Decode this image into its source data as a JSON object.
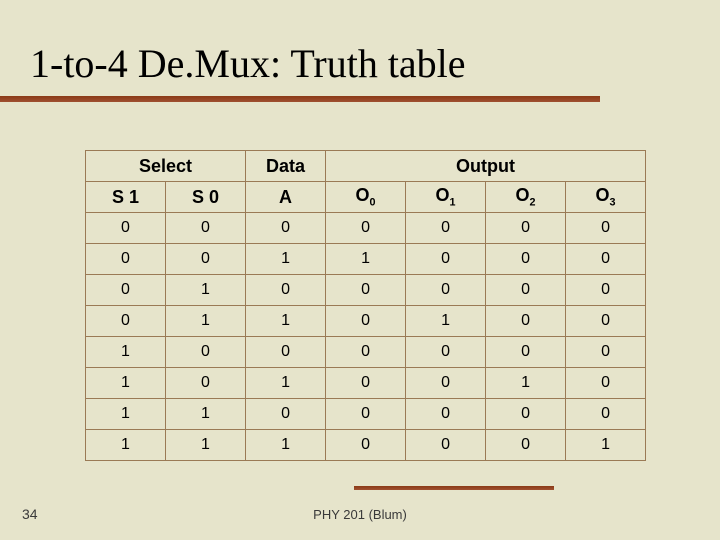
{
  "title": "1-to-4 De.Mux: Truth table",
  "footer": "PHY 201 (Blum)",
  "slide_number": "34",
  "table": {
    "group_headers": {
      "select": "Select",
      "data": "Data",
      "output": "Output"
    },
    "col_headers": {
      "s1": "S 1",
      "s0": "S 0",
      "a": "A",
      "o0_label": "O",
      "o0_sub": "0",
      "o1_label": "O",
      "o1_sub": "1",
      "o2_label": "O",
      "o2_sub": "2",
      "o3_label": "O",
      "o3_sub": "3"
    },
    "rows": [
      {
        "s1": "0",
        "s0": "0",
        "a": "0",
        "o0": "0",
        "o1": "0",
        "o2": "0",
        "o3": "0"
      },
      {
        "s1": "0",
        "s0": "0",
        "a": "1",
        "o0": "1",
        "o1": "0",
        "o2": "0",
        "o3": "0"
      },
      {
        "s1": "0",
        "s0": "1",
        "a": "0",
        "o0": "0",
        "o1": "0",
        "o2": "0",
        "o3": "0"
      },
      {
        "s1": "0",
        "s0": "1",
        "a": "1",
        "o0": "0",
        "o1": "1",
        "o2": "0",
        "o3": "0"
      },
      {
        "s1": "1",
        "s0": "0",
        "a": "0",
        "o0": "0",
        "o1": "0",
        "o2": "0",
        "o3": "0"
      },
      {
        "s1": "1",
        "s0": "0",
        "a": "1",
        "o0": "0",
        "o1": "0",
        "o2": "1",
        "o3": "0"
      },
      {
        "s1": "1",
        "s0": "1",
        "a": "0",
        "o0": "0",
        "o1": "0",
        "o2": "0",
        "o3": "0"
      },
      {
        "s1": "1",
        "s0": "1",
        "a": "1",
        "o0": "0",
        "o1": "0",
        "o2": "0",
        "o3": "1"
      }
    ]
  },
  "chart_data": {
    "type": "table",
    "title": "1-to-4 DeMux Truth Table",
    "columns": [
      "S1",
      "S0",
      "A",
      "O0",
      "O1",
      "O2",
      "O3"
    ],
    "rows": [
      [
        0,
        0,
        0,
        0,
        0,
        0,
        0
      ],
      [
        0,
        0,
        1,
        1,
        0,
        0,
        0
      ],
      [
        0,
        1,
        0,
        0,
        0,
        0,
        0
      ],
      [
        0,
        1,
        1,
        0,
        1,
        0,
        0
      ],
      [
        1,
        0,
        0,
        0,
        0,
        0,
        0
      ],
      [
        1,
        0,
        1,
        0,
        0,
        1,
        0
      ],
      [
        1,
        1,
        0,
        0,
        0,
        0,
        0
      ],
      [
        1,
        1,
        1,
        0,
        0,
        0,
        1
      ]
    ]
  }
}
